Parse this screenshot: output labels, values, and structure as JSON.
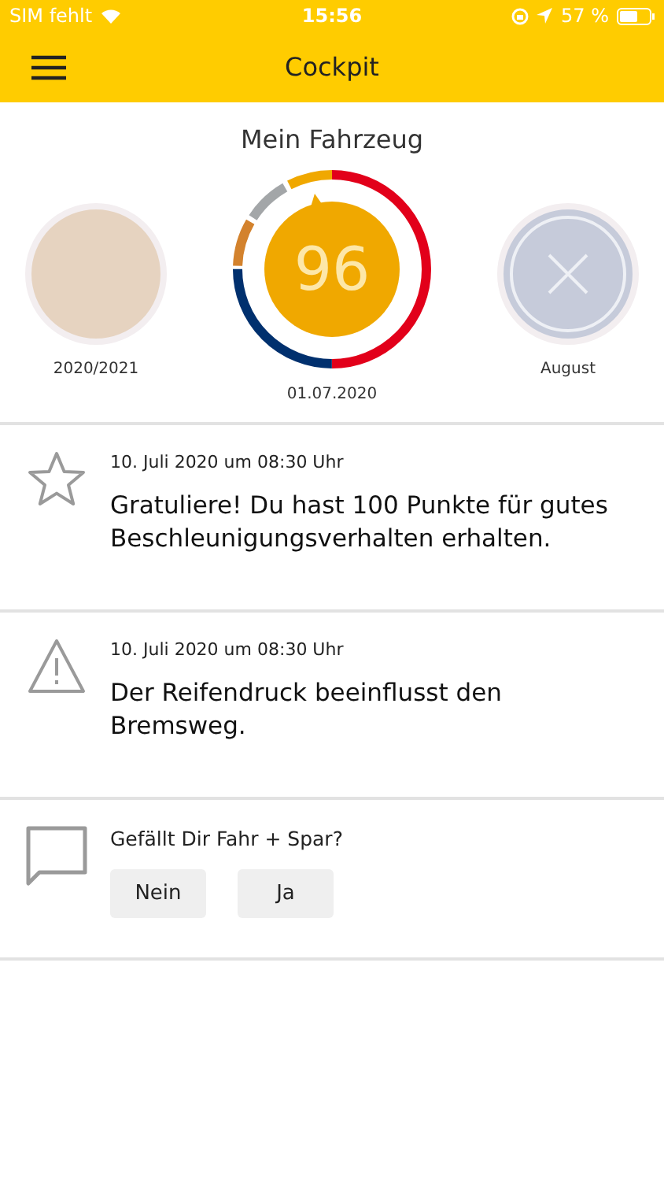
{
  "status_bar": {
    "carrier": "SIM fehlt",
    "time": "15:56",
    "battery": "57 %"
  },
  "header": {
    "title": "Cockpit"
  },
  "vehicle": {
    "title": "Mein Fahrzeug",
    "badges": [
      {
        "kind": "medal",
        "label": "2020/2021"
      },
      {
        "kind": "score",
        "value": "96",
        "label": "01.07.2020"
      },
      {
        "kind": "missed",
        "label": "August"
      }
    ]
  },
  "feed": [
    {
      "kind": "star",
      "time": "10. Juli 2020 um 08:30 Uhr",
      "message": "Gratuliere! Du hast 100 Punkte für gutes Beschleunigungsverhalten erhalten."
    },
    {
      "kind": "warning",
      "time": "10. Juli 2020 um 08:30 Uhr",
      "message": "Der Reifendruck beeinflusst den Bremsweg."
    },
    {
      "kind": "feedback",
      "question": "Gefällt Dir Fahr + Spar?",
      "buttons": [
        "Nein",
        "Ja"
      ]
    }
  ]
}
